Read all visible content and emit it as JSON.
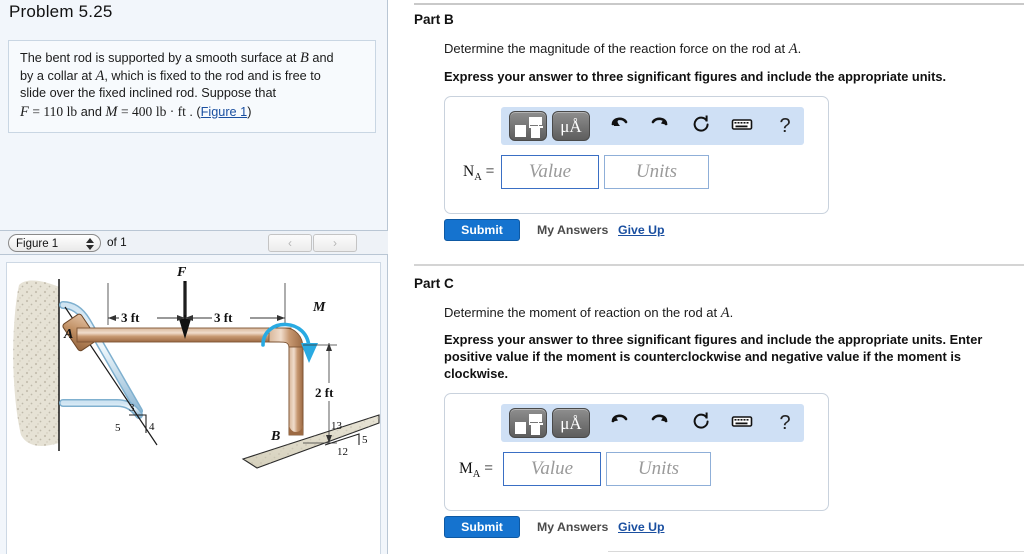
{
  "problem": {
    "title": "Problem 5.25",
    "text_line1_a": "The bent rod is supported by a smooth surface at ",
    "text_B": "B",
    "text_line1_b": " and",
    "text_line2_a": "by a collar at ",
    "text_A": "A",
    "text_line2_b": ", which is fixed to the rod and is free to",
    "text_line3": "slide over the fixed inclined rod. Suppose that",
    "var_F": "F",
    "eq1": "= 110",
    "unit1": "lb",
    "and": "and",
    "var_M": "M",
    "eq2": "= 400",
    "unit2": "lb · ft",
    "period": ".",
    "figure_link": "Figure 1",
    "paren_open": "(",
    "paren_close": ")"
  },
  "figure_bar": {
    "selected_figure": "Figure 1",
    "of_label": "of 1",
    "prev_label": "‹",
    "next_label": "›"
  },
  "figure": {
    "force_label": "F",
    "moment_label": "M",
    "point_a": "A",
    "point_b": "B",
    "dim_left": "3 ft",
    "dim_right": "3 ft",
    "dim_vert": "2 ft",
    "slope_a_3": "3",
    "slope_a_4": "4",
    "slope_a_5": "5",
    "slope_b_13": "13",
    "slope_b_12": "12",
    "slope_b_5": "5"
  },
  "parts": [
    {
      "heading": "Part B",
      "question": "Determine the magnitude of the reaction force on the rod at ",
      "question_var": "A",
      "question_end": ".",
      "instruction": "Express your answer to three significant figures and include the appropriate units.",
      "answer_label": "N",
      "answer_sub": "A",
      "answer_eq": " =",
      "value_placeholder": "Value",
      "units_placeholder": "Units",
      "submit_label": "Submit",
      "my_answers_label": "My Answers",
      "give_up_label": "Give Up"
    },
    {
      "heading": "Part C",
      "question": "Determine the moment of reaction on the rod at ",
      "question_var": "A",
      "question_end": ".",
      "instruction_line1": "Express your answer to three significant figures and include the appropriate units. Enter",
      "instruction_line2": "positive value if the moment is counterclockwise and negative value if the moment is",
      "instruction_line3": "clockwise.",
      "answer_label": "M",
      "answer_sub": "A",
      "answer_eq": " =",
      "value_placeholder": "Value",
      "units_placeholder": "Units",
      "submit_label": "Submit",
      "my_answers_label": "My Answers",
      "give_up_label": "Give Up"
    }
  ],
  "toolbar": {
    "template_icon": "template-icon",
    "units_icon": "μÅ",
    "undo_icon": "undo-icon",
    "redo_icon": "redo-icon",
    "reset_icon": "reset-icon",
    "keyboard_icon": "keyboard-icon",
    "help_icon": "?"
  },
  "colors": {
    "accent_blue": "#1573cf",
    "link_blue": "#1a4fa0",
    "toolbar_bg": "#cfe0f5",
    "panel_bg": "#f2f6fb",
    "rod_brown": "#b5825e",
    "moment_cyan": "#29aae2"
  }
}
